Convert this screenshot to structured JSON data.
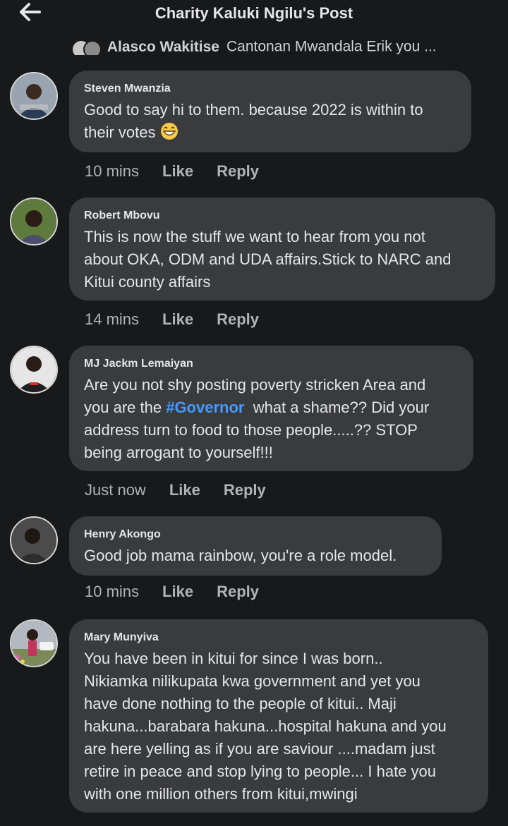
{
  "header": {
    "title": "Charity Kaluki Ngilu's Post",
    "back_icon": "arrow-left-icon"
  },
  "previous_reply": {
    "author": "Alasco Wakitise",
    "text": "Cantonan Mwandala Erik you ..."
  },
  "actions": {
    "like": "Like",
    "reply": "Reply"
  },
  "hashtag": "#Governor",
  "comments": [
    {
      "author": "Steven Mwanzia",
      "line1": "Good to say hi to them. because 2022 is within to",
      "line2": "their votes",
      "emoji": "grinning-face-icon",
      "time": "10 mins"
    },
    {
      "author": "Robert Mbovu",
      "line1": "This is now the stuff we want to hear from you not",
      "line2": "about OKA, ODM and UDA affairs.Stick to NARC and",
      "line3": "Kitui county affairs",
      "time": "14 mins"
    },
    {
      "author": "MJ Jackm Lemaiyan",
      "line1": "Are you not shy posting poverty stricken Area and",
      "line2a": "you are the",
      "line2b": "what a shame?? Did your",
      "line3": "address turn to food to those people.....?? STOP",
      "line4": "being arrogant to yourself!!!",
      "time": "Just now"
    },
    {
      "author": "Henry Akongo",
      "line1": "Good job mama rainbow, you're a role model.",
      "time": "10 mins"
    },
    {
      "author": "Mary Munyiva",
      "line1": "You have been in kitui for since I was born..",
      "line2": "Nikiamka nilikupata kwa government and yet you",
      "line3": "have done nothing to the people of kitui.. Maji",
      "line4": "hakuna...barabara hakuna...hospital hakuna and you",
      "line5": "are here yelling as if you are saviour ....madam just",
      "line6": "retire in peace and stop lying to people... I hate you",
      "line7": "with one million others from kitui,mwingi"
    }
  ]
}
